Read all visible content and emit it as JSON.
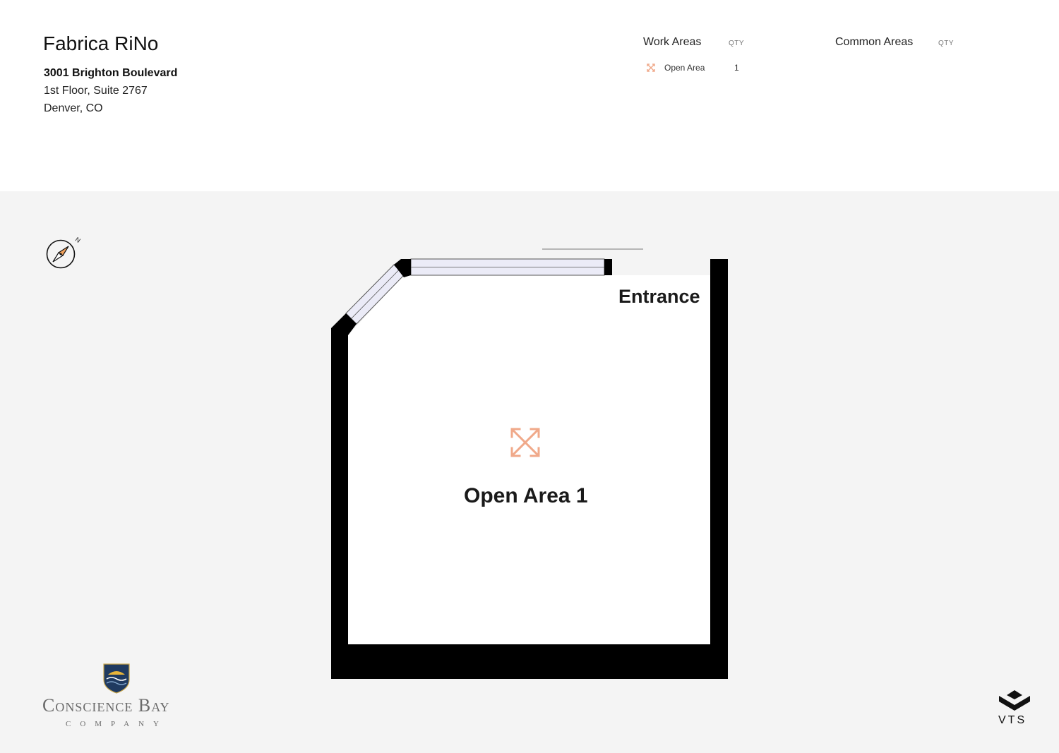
{
  "header": {
    "title": "Fabrica RiNo",
    "address_line1": "3001 Brighton Boulevard",
    "address_line2": "1st Floor, Suite 2767",
    "address_line3": "Denver, CO"
  },
  "legend": {
    "work_areas_label": "Work Areas",
    "work_qty_label": "QTY",
    "common_areas_label": "Common Areas",
    "common_qty_label": "QTY",
    "work_items": [
      {
        "icon": "open-area-icon",
        "label": "Open Area",
        "qty": "1"
      }
    ]
  },
  "plan": {
    "compass_north": "N",
    "entrance_label": "Entrance",
    "room_label": "Open Area 1"
  },
  "branding": {
    "left_logo_name": "Conscience Bay",
    "left_logo_sub": "COMPANY",
    "right_logo_text": "VTS"
  },
  "colors": {
    "accent_open_area": "#f0a98a",
    "wall": "#000000",
    "window_fill": "#ebebf7",
    "background": "#f4f4f4"
  }
}
